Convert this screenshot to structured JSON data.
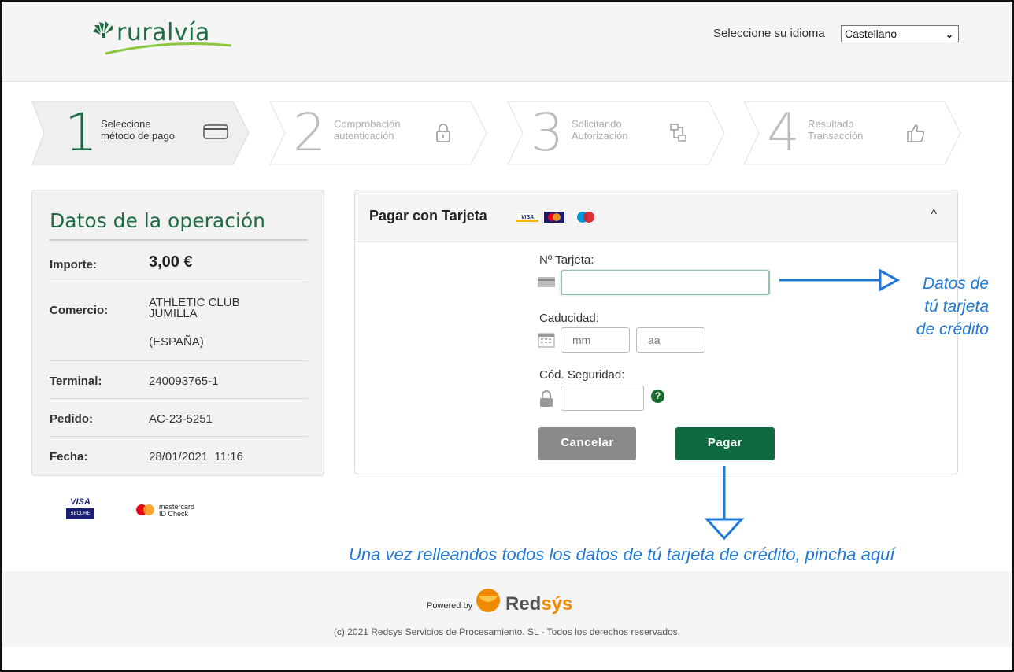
{
  "header": {
    "brand": "ruralvía",
    "language_label": "Seleccione su idioma",
    "language_selected": "Castellano"
  },
  "steps": [
    {
      "number": "1",
      "label_line1": "Seleccione",
      "label_line2": "método de pago",
      "icon": "credit-card-icon",
      "active": true
    },
    {
      "number": "2",
      "label_line1": "Comprobación",
      "label_line2": "autenticación",
      "icon": "lock-icon",
      "active": false
    },
    {
      "number": "3",
      "label_line1": "Solicitando",
      "label_line2": "Autorización",
      "icon": "network-icon",
      "active": false
    },
    {
      "number": "4",
      "label_line1": "Resultado",
      "label_line2": "Transacción",
      "icon": "thumbs-up-icon",
      "active": false
    }
  ],
  "operation": {
    "title": "Datos de la operación",
    "importe_label": "Importe:",
    "importe_value": "3,00 €",
    "comercio_label": "Comercio:",
    "comercio_line1": "ATHLETIC CLUB",
    "comercio_line2": "JUMILLA",
    "comercio_line3": "(ESPAÑA)",
    "terminal_label": "Terminal:",
    "terminal_value": "240093765-1",
    "pedido_label": "Pedido:",
    "pedido_value": "AC-23-5251",
    "fecha_label": "Fecha:",
    "fecha_value": "28/01/2021  11:16"
  },
  "payment": {
    "title": "Pagar con Tarjeta",
    "card_number_label": "Nº Tarjeta:",
    "card_number_value": "",
    "expiry_label": "Caducidad:",
    "month_placeholder": "mm",
    "year_placeholder": "aa",
    "cvv_label": "Cód. Seguridad:",
    "cvv_value": "",
    "help_glyph": "?",
    "cancel_label": "Cancelar",
    "pay_label": "Pagar"
  },
  "badges": {
    "visa_line1": "VISA",
    "visa_line2": "SECURE",
    "mc_line1": "mastercard",
    "mc_line2": "ID Check"
  },
  "annotations": {
    "card_line1": "Datos de",
    "card_line2": "tú tarjeta",
    "card_line3": "de crédito",
    "pay_hint": "Una vez relleandos todos los datos de tú tarjeta de crédito, pincha aquí"
  },
  "footer": {
    "powered_by": "Powered by",
    "redsys_red": "Red",
    "redsys_rest": "sýs",
    "copyright": "(c) 2021 Redsys Servicios de Procesamiento. SL - Todos los derechos reservados."
  },
  "colors": {
    "brand_green": "#1f6b43",
    "pay_button": "#0f6b3f",
    "cancel_button": "#8a8a8a",
    "annotation_blue": "#1f78d6",
    "redsys_orange": "#f08a00"
  }
}
